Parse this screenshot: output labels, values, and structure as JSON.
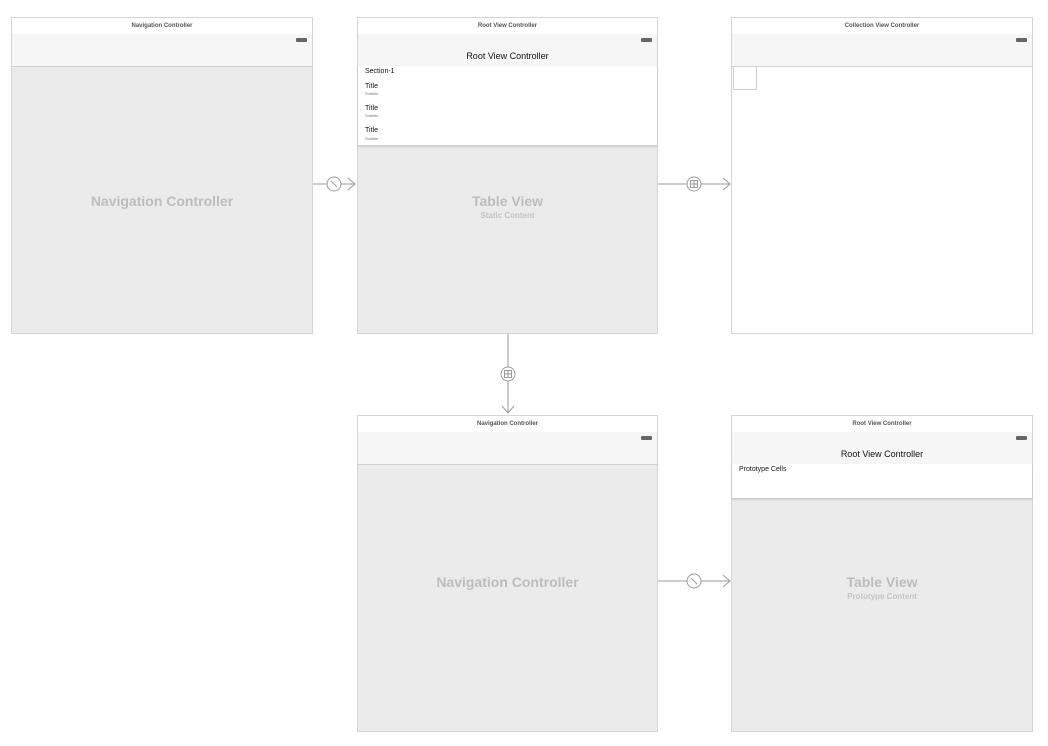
{
  "scenes": {
    "nav1": {
      "title": "Navigation Controller",
      "body_label": "Navigation Controller"
    },
    "root1": {
      "title": "Root View Controller",
      "nav_title": "Root View Controller",
      "section_header": "Section-1",
      "cells": [
        {
          "title": "Title",
          "subtitle": "Subtitle"
        },
        {
          "title": "Title",
          "subtitle": "Subtitle"
        },
        {
          "title": "Title",
          "subtitle": "Subtitle"
        }
      ],
      "body_label": "Table View",
      "body_sublabel": "Static Content"
    },
    "collection": {
      "title": "Collection View Controller"
    },
    "nav2": {
      "title": "Navigation Controller",
      "body_label": "Navigation Controller"
    },
    "root2": {
      "title": "Root View Controller",
      "nav_title": "Root View Controller",
      "prototype_label": "Prototype Cells",
      "body_label": "Table View",
      "body_sublabel": "Prototype Content"
    }
  },
  "segues": [
    {
      "from": "nav1",
      "to": "root1",
      "icon": "relationship-segue-icon"
    },
    {
      "from": "root1",
      "to": "collection",
      "icon": "show-segue-icon"
    },
    {
      "from": "root1",
      "to": "nav2",
      "icon": "show-segue-icon"
    },
    {
      "from": "nav2",
      "to": "root2",
      "icon": "relationship-segue-icon"
    }
  ],
  "colors": {
    "canvas": "#ffffff",
    "scene_border": "#d4d4d4",
    "bar": "#f6f6f6",
    "placeholder_body": "#ebebeb",
    "placeholder_text": "#bdbdbd",
    "segue_line": "#9a9a9a"
  }
}
